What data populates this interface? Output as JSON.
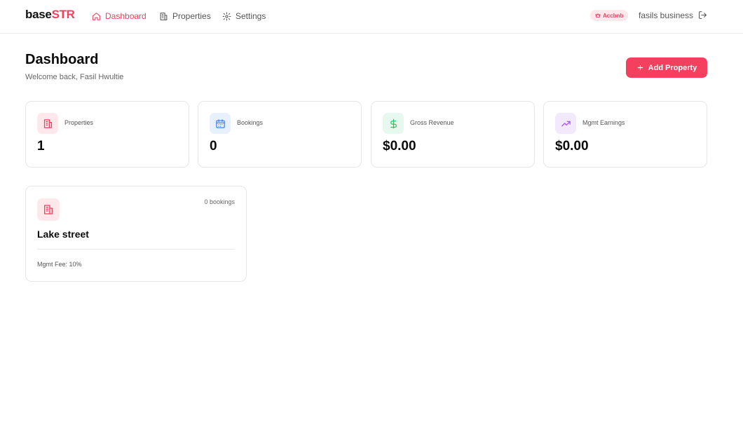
{
  "brand": {
    "part1": "base",
    "part2": "STR"
  },
  "nav": [
    {
      "label": "Dashboard",
      "icon": "home-icon",
      "active": true
    },
    {
      "label": "Properties",
      "icon": "building-icon",
      "active": false
    },
    {
      "label": "Settings",
      "icon": "gear-icon",
      "active": false
    }
  ],
  "account": {
    "badge": "Accbnb",
    "business": "fasils business"
  },
  "header": {
    "title": "Dashboard",
    "welcome": "Welcome back, Fasil Hwultie",
    "add_button": "Add Property"
  },
  "stats": [
    {
      "label": "Properties",
      "value": "1",
      "icon": "building-icon",
      "color": "#f43f5e",
      "bg": "#fde8ec"
    },
    {
      "label": "Bookings",
      "value": "0",
      "icon": "calendar-icon",
      "color": "#3b82f6",
      "bg": "#e8f0fe"
    },
    {
      "label": "Gross Revenue",
      "value": "$0.00",
      "icon": "dollar-icon",
      "color": "#22c55e",
      "bg": "#e7f8ee"
    },
    {
      "label": "Mgmt Earnings",
      "value": "$0.00",
      "icon": "trending-up-icon",
      "color": "#a855f7",
      "bg": "#f3e9fd"
    }
  ],
  "property": {
    "name": "Lake street",
    "bookings": "0 bookings",
    "fee": "Mgmt Fee: 10%"
  }
}
